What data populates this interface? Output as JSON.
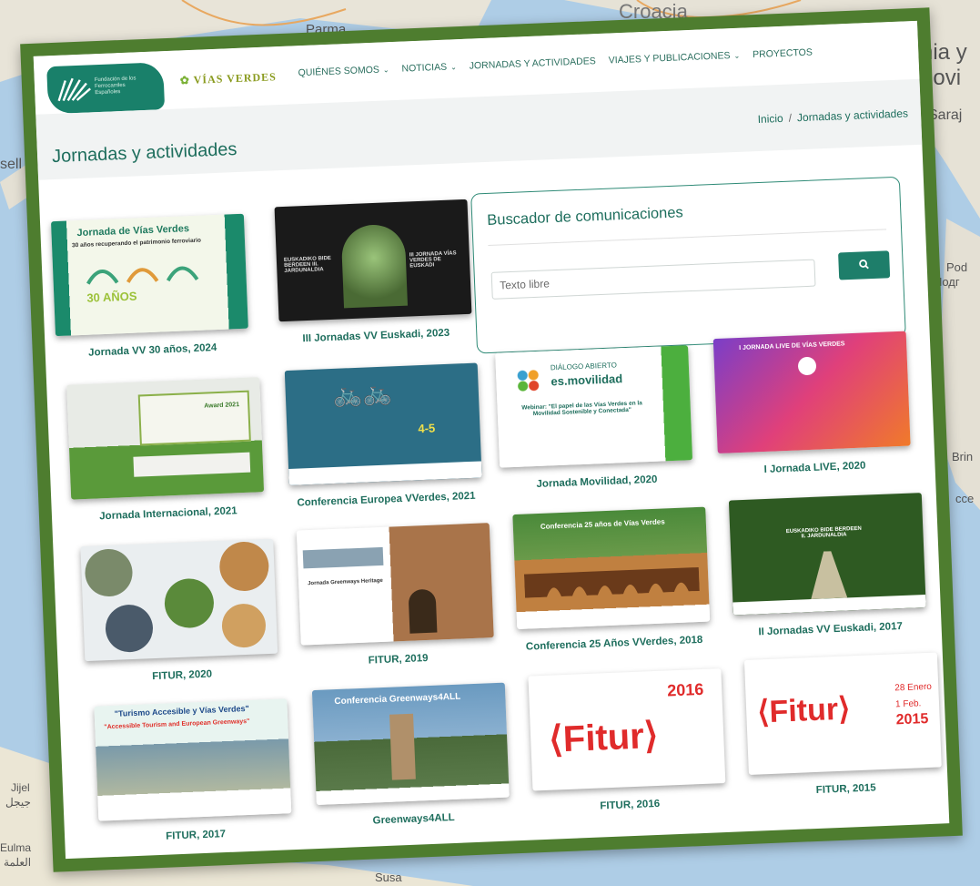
{
  "header": {
    "logo_text": [
      "Fundación de los",
      "Ferrocarriles",
      "Españoles"
    ],
    "vias_logo": "VÍAS VERDES",
    "nav": [
      {
        "label": "QUIÉNES SOMOS",
        "has_dropdown": true
      },
      {
        "label": "NOTICIAS",
        "has_dropdown": true
      },
      {
        "label": "JORNADAS Y ACTIVIDADES",
        "has_dropdown": false
      },
      {
        "label": "VIAJES Y PUBLICACIONES",
        "has_dropdown": true
      },
      {
        "label": "PROYECTOS",
        "has_dropdown": false
      }
    ]
  },
  "page_title": "Jornadas y actividades",
  "breadcrumb": {
    "home": "Inicio",
    "separator": "/",
    "current": "Jornadas y actividades"
  },
  "search": {
    "title": "Buscador de comunicaciones",
    "placeholder": "Texto libre",
    "button_icon": "search-icon"
  },
  "cards": [
    {
      "caption": "Jornada VV 30 años, 2024",
      "thumb_text": "Jornada de Vías Verdes",
      "thumb_sub": "30 años recuperando el patrimonio ferroviario",
      "thumb_badge": "30 AÑOS"
    },
    {
      "caption": "III Jornadas VV Euskadi, 2023",
      "thumb_text": "EUSKADIKO BIDE BERDEEN III. JARDUNALDIA",
      "thumb_sub": "III JORNADA VÍAS VERDES DE EUSKADI"
    },
    {
      "caption": "Jornada Internacional, 2021",
      "thumb_text": "Award 2021"
    },
    {
      "caption": "Conferencia Europea VVerdes, 2021",
      "thumb_text": "4-5"
    },
    {
      "caption": "Jornada Movilidad, 2020",
      "thumb_text": "DIÁLOGO ABIERTO",
      "thumb_sub": "es.movilidad",
      "thumb_note": "Webinar: \"El papel de las Vías Verdes en la Movilidad Sostenible y Conectada\""
    },
    {
      "caption": "I Jornada LIVE, 2020",
      "thumb_text": "I JORNADA LIVE DE VÍAS VERDES"
    },
    {
      "caption": "FITUR, 2020"
    },
    {
      "caption": "FITUR, 2019",
      "thumb_text": "Jornada Greenways Heritage"
    },
    {
      "caption": "Conferencia 25 Años VVerdes, 2018",
      "thumb_text": "Conferencia 25 años de Vías Verdes"
    },
    {
      "caption": "II Jornadas VV Euskadi, 2017",
      "thumb_text": "EUSKADIKO BIDE BERDEEN II. JARDUNALDIA"
    },
    {
      "caption": "FITUR, 2017",
      "thumb_text": "\"Turismo Accesible y Vías Verdes\"",
      "thumb_sub": "\"Accessible Tourism and European Greenways\""
    },
    {
      "caption": "Greenways4ALL",
      "thumb_text": "Conferencia Greenways4ALL"
    },
    {
      "caption": "FITUR, 2016",
      "thumb_text": "Fitur",
      "thumb_year": "2016"
    },
    {
      "caption": "FITUR, 2015",
      "thumb_text": "Fitur",
      "thumb_date": "28 Enero",
      "thumb_date2": "1 Feb.",
      "thumb_year": "2015"
    }
  ],
  "map_labels": {
    "top_center": "Croacia",
    "top_left": "Parma",
    "right_1": "nia y",
    "right_2": "govi",
    "right_3": "Saraj",
    "right_4": "Pod",
    "right_5": "Подг",
    "right_6": "Brin",
    "right_7": "cce",
    "left_1": "sell",
    "bottom_left_1": "Jijel",
    "bottom_left_2": "جيجل",
    "bottom_left_3": "Eulma",
    "bottom_left_4": "العلمة",
    "bottom_center": "Susa"
  },
  "colors": {
    "frame": "#4e7d2f",
    "accent": "#1e7e6a",
    "caption": "#1e6e5d"
  }
}
